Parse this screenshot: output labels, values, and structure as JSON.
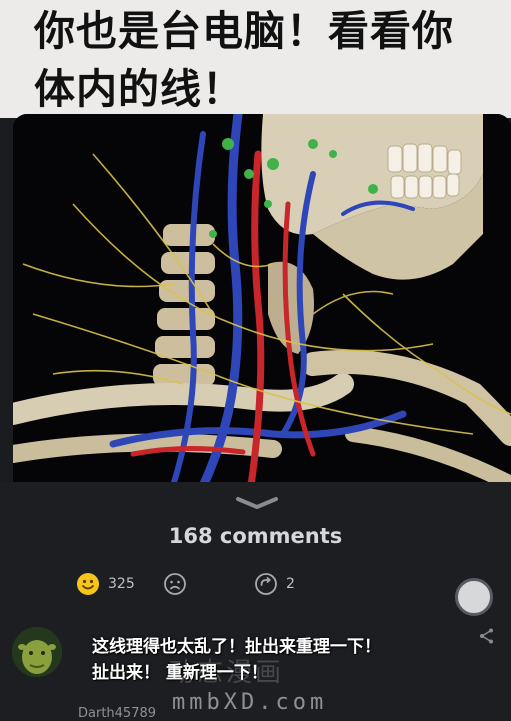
{
  "post": {
    "headline_lines": [
      "你也是台电脑！看看你",
      "体内的线！"
    ]
  },
  "thread": {
    "comments_label": "168 comments",
    "like_count": "325",
    "share_count": "2"
  },
  "comment": {
    "lines": [
      "这线理得也太乱了！扯出来重理一下！",
      "扯出来！  重新理一下！"
    ],
    "username": "Darth45789"
  },
  "watermark": {
    "text": "mmbXD.com",
    "cn_text": "动态漫画"
  },
  "colors": {
    "sheet_bg": "#1d1e22",
    "emoji_yellow": "#f5c518",
    "text_muted": "#bfc0c4"
  },
  "icons": [
    "chevron-down-icon",
    "smile-emoji-icon",
    "sad-face-icon",
    "repost-icon",
    "record-button-icon",
    "share-icon"
  ]
}
